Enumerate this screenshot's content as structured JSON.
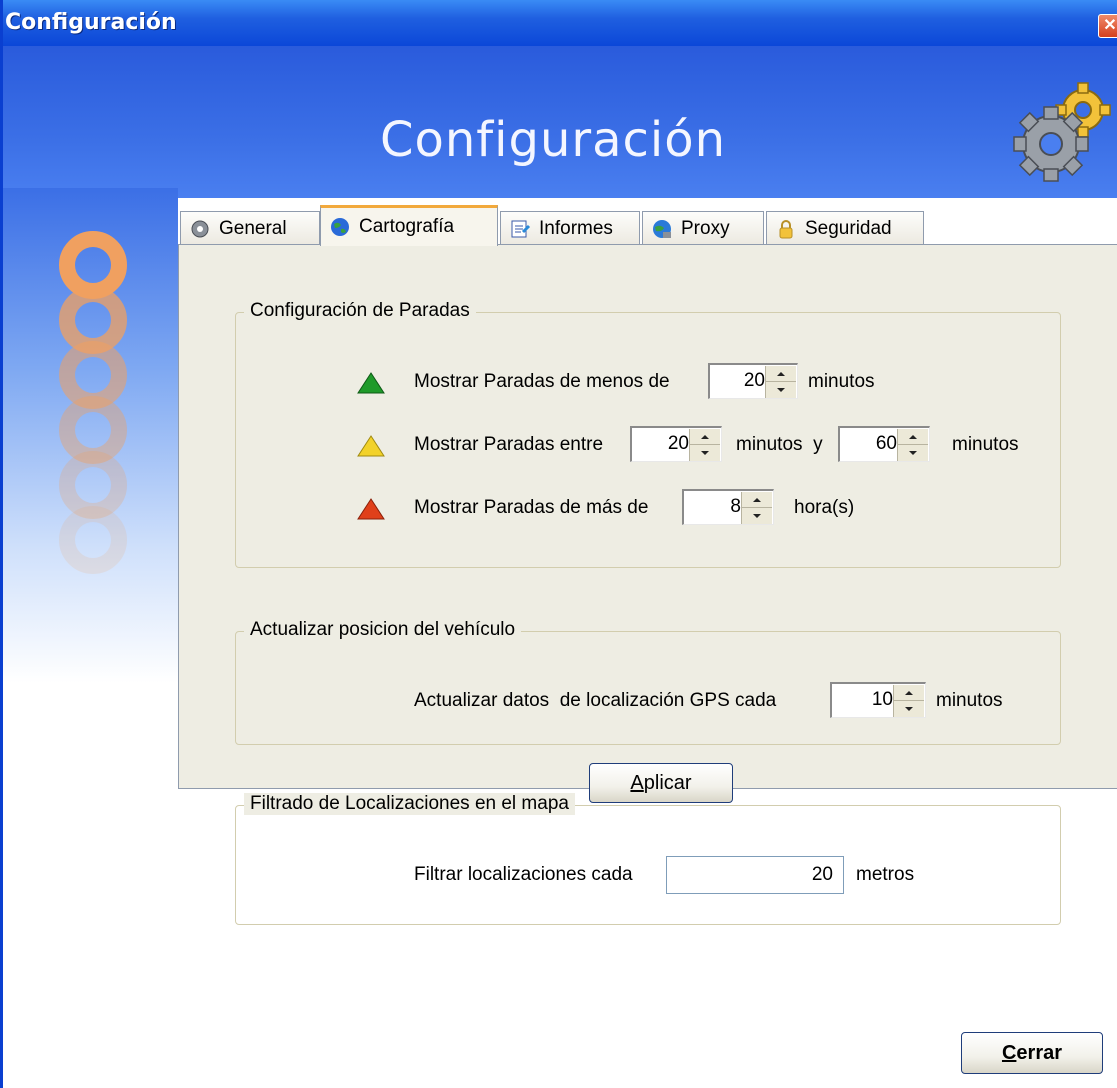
{
  "window": {
    "title": "Configuración",
    "close_glyph": "✕"
  },
  "header": {
    "title": "Configuración",
    "gears_icon": "gears-icon"
  },
  "tabs": [
    {
      "label": "General",
      "icon": "gear-icon",
      "active": false
    },
    {
      "label": "Cartografía",
      "icon": "globe-icon",
      "active": true
    },
    {
      "label": "Informes",
      "icon": "report-icon",
      "active": false
    },
    {
      "label": "Proxy",
      "icon": "network-globe-icon",
      "active": false
    },
    {
      "label": "Seguridad",
      "icon": "lock-icon",
      "active": false
    }
  ],
  "stops": {
    "title": "Configuración de Paradas",
    "row1": {
      "text": "Mostrar Paradas de menos de",
      "value": "20",
      "unit": "minutos",
      "icon_color": "#1f9a2a"
    },
    "row2": {
      "text": "Mostrar Paradas entre",
      "value1": "20",
      "middle": "minutos  y",
      "value2": "60",
      "unit": "minutos",
      "icon_color": "#f2d22a"
    },
    "row3": {
      "text": "Mostrar Paradas de más de",
      "value": "8",
      "unit": "hora(s)",
      "icon_color": "#e0401a"
    }
  },
  "vehicle": {
    "title": "Actualizar posicion del vehículo",
    "text": "Actualizar datos  de localización GPS cada",
    "value": "10",
    "unit": "minutos"
  },
  "filter": {
    "title": "Filtrado de Localizaciones en el mapa",
    "text": "Filtrar localizaciones cada",
    "value": "20",
    "unit": "metros"
  },
  "buttons": {
    "apply_mnemonic": "A",
    "apply_rest": "plicar",
    "close_mnemonic": "C",
    "close_rest": "errar"
  }
}
